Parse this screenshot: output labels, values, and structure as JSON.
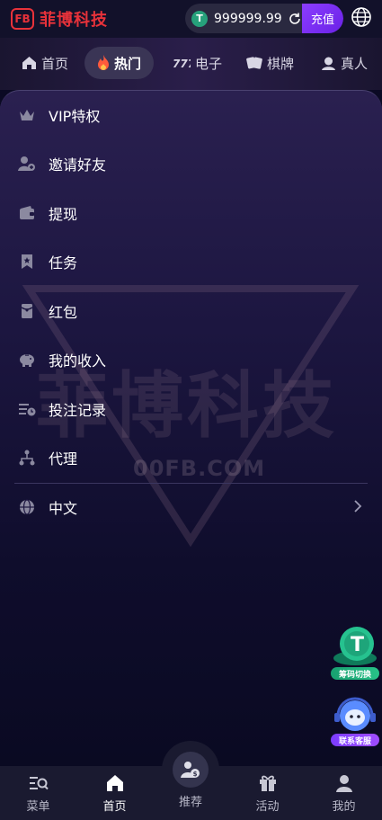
{
  "header": {
    "logo_mark": "FB",
    "logo_text": "菲博科技",
    "currency_symbol": "T",
    "balance": "999999.99",
    "recharge_label": "充值"
  },
  "nav": {
    "tabs": [
      {
        "label": "首页",
        "icon": "home-icon",
        "active": false
      },
      {
        "label": "热门",
        "icon": "flame-icon",
        "active": true
      },
      {
        "label": "电子",
        "icon": "slot-777-icon",
        "active": false
      },
      {
        "label": "棋牌",
        "icon": "cards-icon",
        "active": false
      },
      {
        "label": "真人",
        "icon": "dealer-icon",
        "active": false
      }
    ]
  },
  "menu": {
    "items": [
      {
        "label": "VIP特权",
        "icon": "crown-icon"
      },
      {
        "label": "邀请好友",
        "icon": "invite-user-icon"
      },
      {
        "label": "提现",
        "icon": "wallet-icon"
      },
      {
        "label": "任务",
        "icon": "task-bookmark-icon"
      },
      {
        "label": "红包",
        "icon": "red-envelope-icon"
      },
      {
        "label": "我的收入",
        "icon": "piggy-bank-icon"
      },
      {
        "label": "投注记录",
        "icon": "bet-record-icon"
      },
      {
        "label": "代理",
        "icon": "agent-network-icon"
      }
    ],
    "language": {
      "label": "中文",
      "icon": "globe-icon"
    }
  },
  "watermark": {
    "text": "菲博科技",
    "domain": "00FB.COM"
  },
  "floating": {
    "chip_exchange_label": "筹码切换",
    "support_label": "联系客服"
  },
  "bottom_nav": {
    "items": [
      {
        "label": "菜单",
        "icon": "menu-search-icon",
        "active": false
      },
      {
        "label": "首页",
        "icon": "home-icon",
        "active": true
      },
      {
        "label": "推荐",
        "icon": "recommend-user-icon",
        "active": false
      },
      {
        "label": "活动",
        "icon": "gift-icon",
        "active": false
      },
      {
        "label": "我的",
        "icon": "profile-icon",
        "active": false
      }
    ]
  },
  "colors": {
    "brand_red": "#e8323a",
    "recharge_purple": "#7a2ff2",
    "usdt_green": "#26a17b",
    "background": "#0b0a24"
  }
}
